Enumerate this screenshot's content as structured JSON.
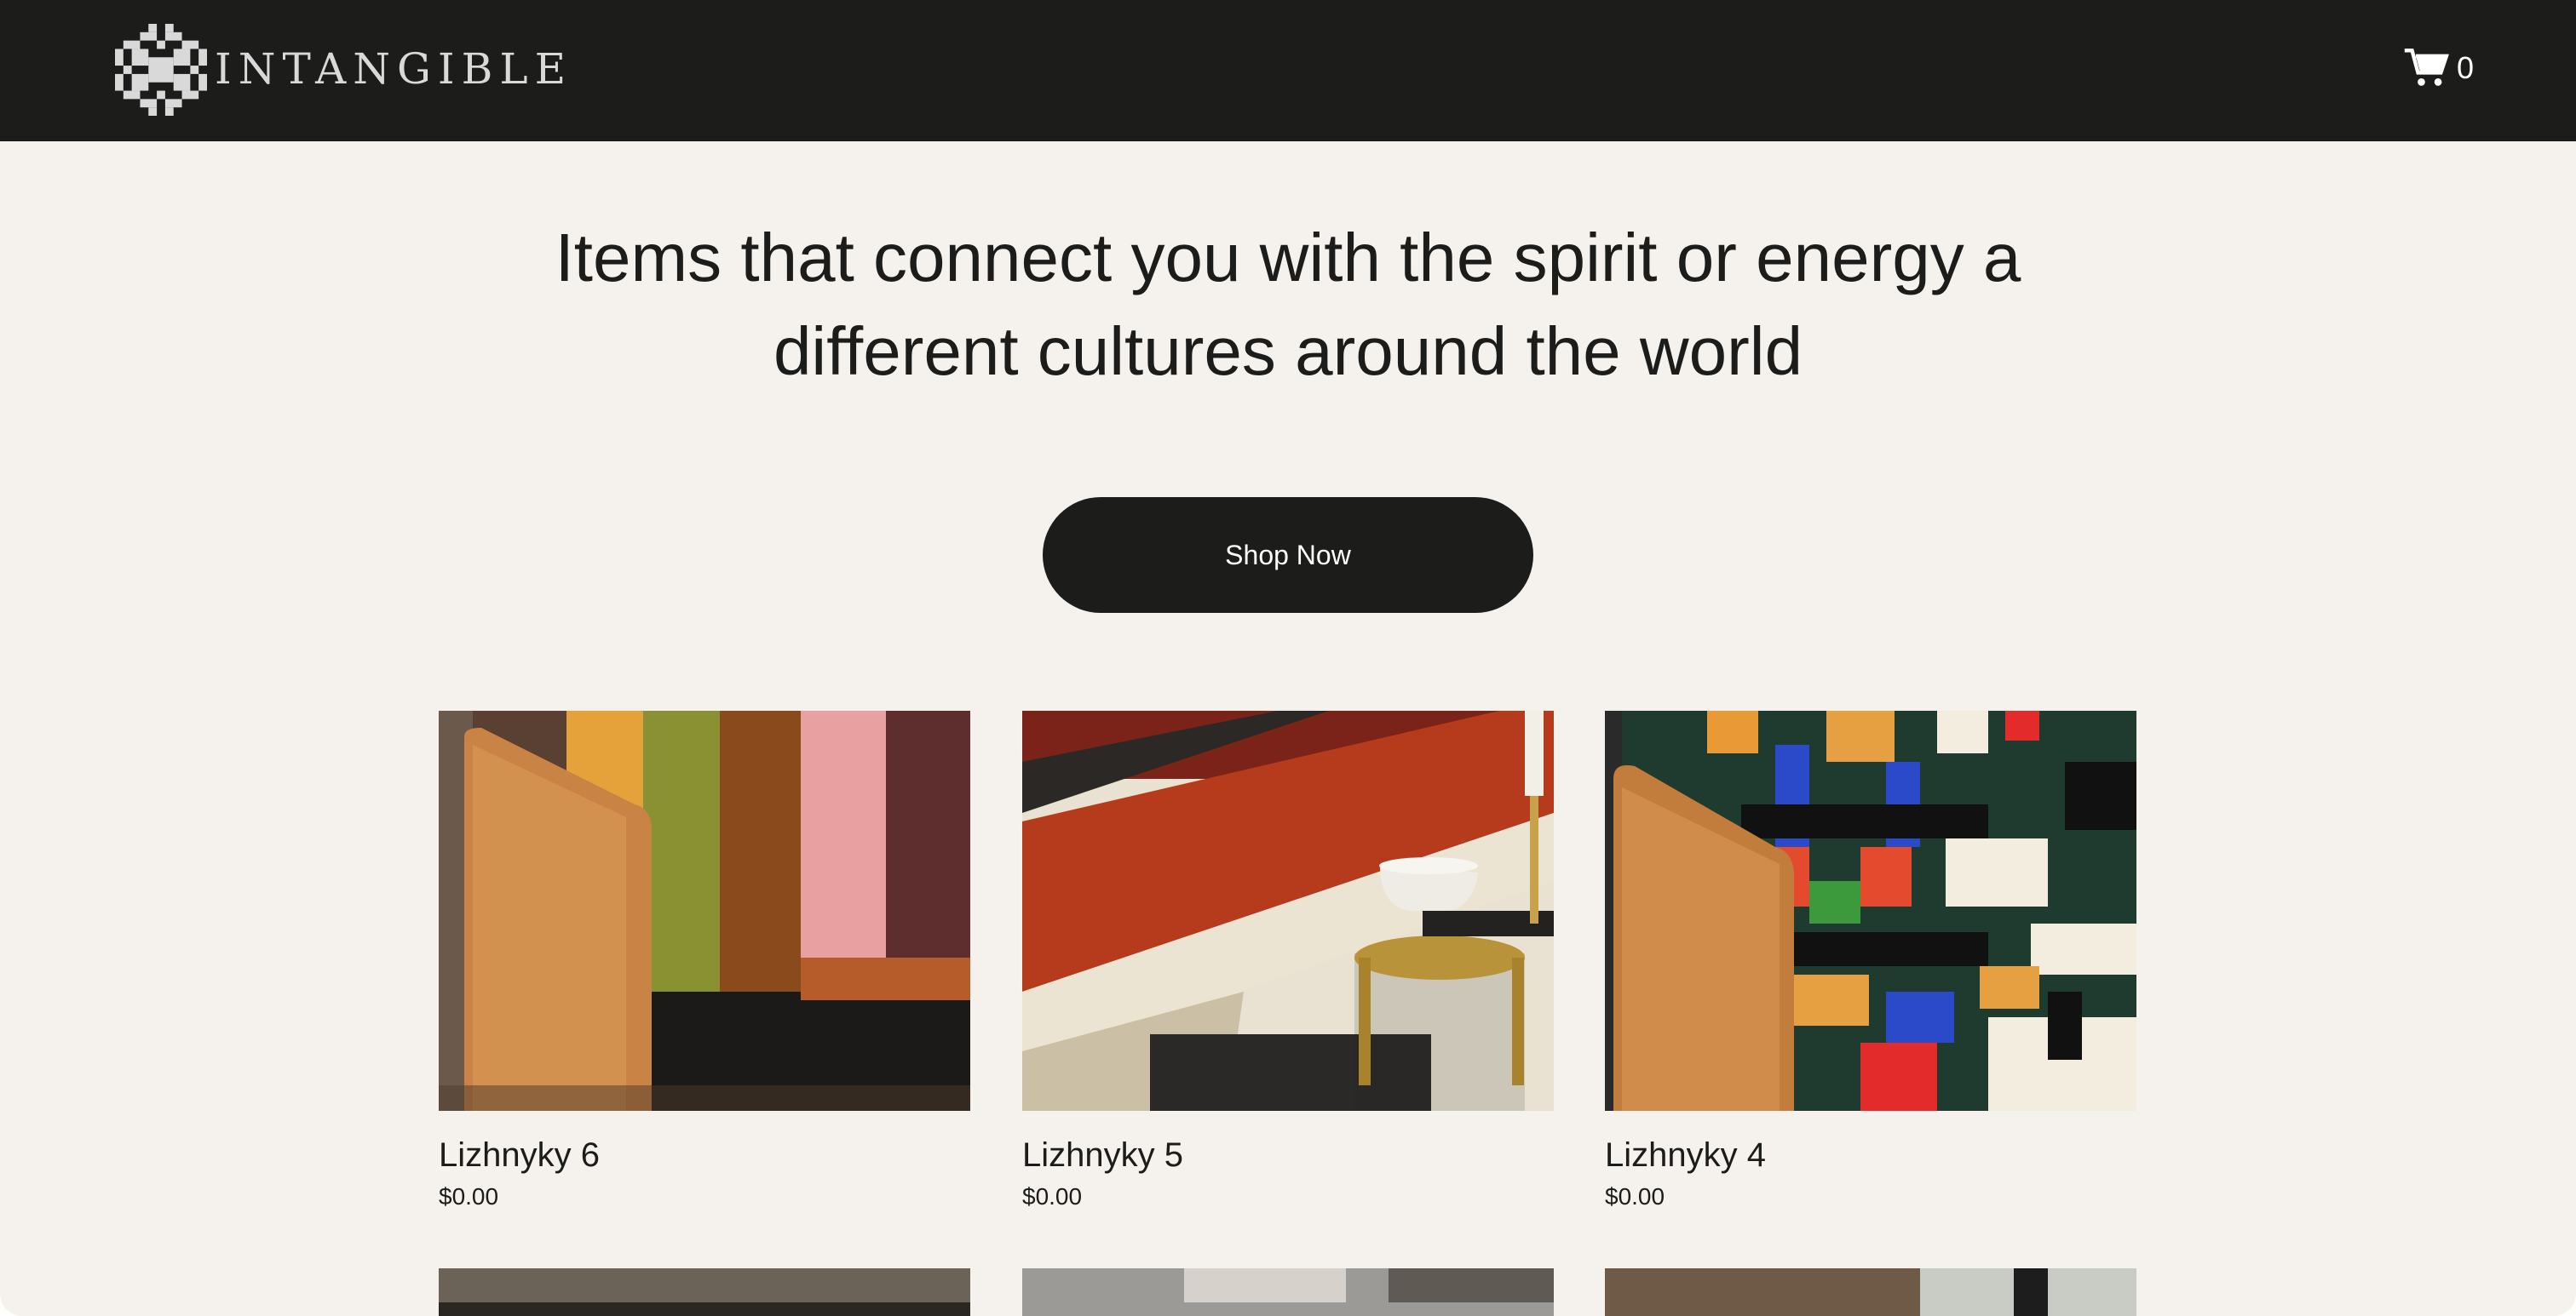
{
  "header": {
    "logo_text": "INTANGIBLE",
    "cart_count": "0"
  },
  "hero": {
    "headline": "Items that connect you with the spirit or energy a different cultures around the world",
    "cta_label": "Shop Now"
  },
  "products": [
    {
      "name": "Lizhnyky 6",
      "price": "$0.00",
      "image": "striped-blanket-on-leather-chair"
    },
    {
      "name": "Lizhnyky 5",
      "price": "$0.00",
      "image": "red-cream-woven-throw-with-side-table"
    },
    {
      "name": "Lizhnyky 4",
      "price": "$0.00",
      "image": "geometric-pattern-blanket-on-leather-chair"
    }
  ],
  "colors": {
    "header_bg": "#1c1c1b",
    "page_bg": "#f5f2ed",
    "button_bg": "#1c1c1b",
    "text": "#1c1c1b"
  },
  "icons": {
    "logo": "ornament-logo-icon",
    "cart": "cart-icon"
  }
}
